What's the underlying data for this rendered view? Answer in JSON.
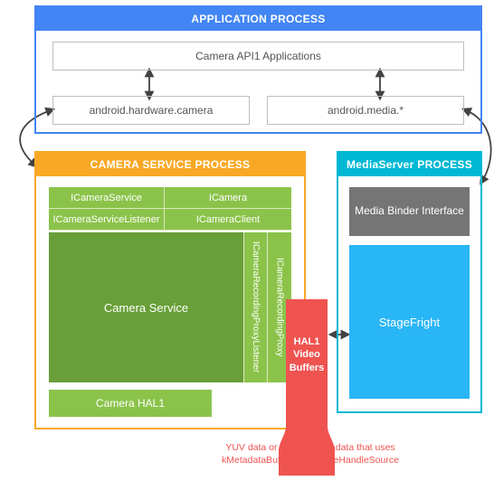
{
  "app_process": {
    "header": "APPLICATION PROCESS",
    "api_apps": "Camera API1 Applications",
    "hw_camera": "android.hardware.camera",
    "media_star": "android.media.*"
  },
  "camera_service_process": {
    "header": "CAMERA SERVICE PROCESS",
    "row1": {
      "a": "ICameraService",
      "b": "ICamera"
    },
    "row2": {
      "a": "ICameraServiceListener",
      "b": "ICameraClient"
    },
    "camera_service": "Camera Service",
    "vert1": "ICameraRecordingProxyListener",
    "vert2": "ICameraRecordingProxy",
    "hal1": "Camera HAL1"
  },
  "mediaserver_process": {
    "header": "MediaServer PROCESS",
    "binder": "Media Binder Interface",
    "stagefright": "StageFright"
  },
  "hal_buffers": {
    "label_l1": "HAL1",
    "label_l2": "Video",
    "label_l3": "Buffers",
    "caption": "YUV data or opaque metadata that uses kMetadataBufferTypeNativeHandleSource"
  }
}
